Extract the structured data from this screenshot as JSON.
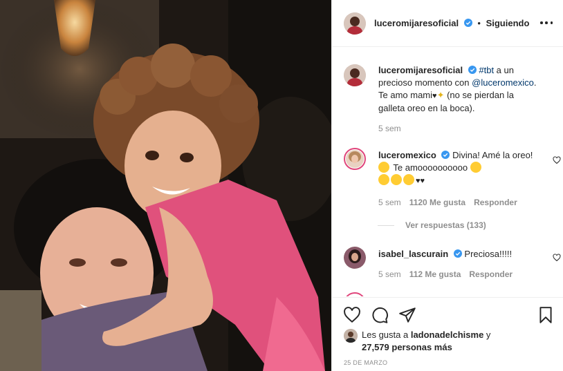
{
  "post": {
    "author": "luceromijaresoficial",
    "follow_status": "Siguiendo",
    "separator": "•"
  },
  "caption": {
    "author": "luceromijaresoficial",
    "hashtag": "#tbt",
    "text_1": " a un precioso momento con ",
    "mention": "@luceromexico",
    "text_2": ". Te amo mami",
    "text_3": " (no se pierdan la galleta oreo en la boca).",
    "time": "5 sem"
  },
  "comments": [
    {
      "author": "luceromexico",
      "text": " Divina! Amé la oreo! ",
      "text_2": " Te amoooooooooo ",
      "time": "5 sem",
      "likes": "1120 Me gusta",
      "reply": "Responder",
      "view_replies": "Ver respuestas (133)"
    },
    {
      "author": "isabel_lascurain",
      "text": " Preciosa!!!!!",
      "time": "5 sem",
      "likes": "112 Me gusta",
      "reply": "Responder"
    }
  ],
  "likes_summary": {
    "prefix": "Les gusta a ",
    "user": "ladonadelchisme",
    "suffix": " y ",
    "others": "27,579 personas más"
  },
  "date": "25 DE MARZO",
  "colors": {
    "verified": "#3897f0",
    "text": "#262626",
    "muted": "#8e8e8e",
    "link": "#00376b",
    "border": "#efefef"
  },
  "icons": [
    "heart-icon",
    "comment-icon",
    "share-icon",
    "bookmark-icon",
    "more-icon",
    "verified-icon"
  ]
}
